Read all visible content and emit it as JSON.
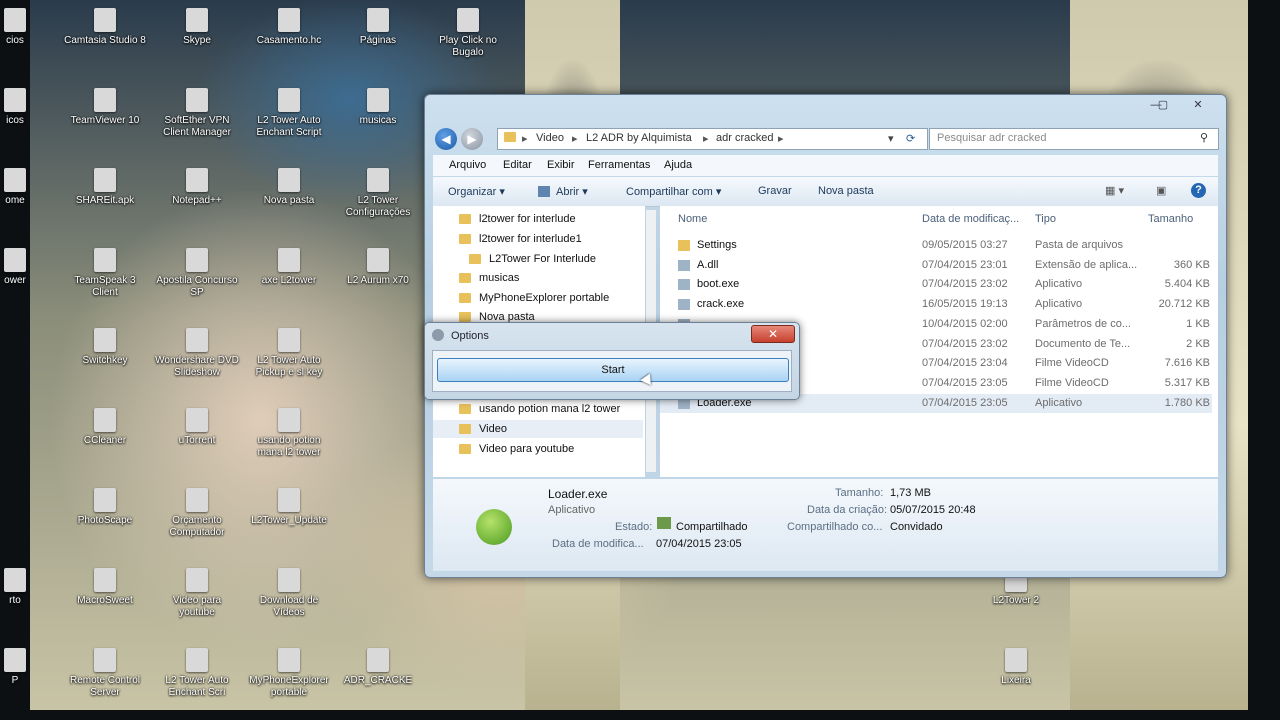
{
  "desktop_icons": [
    {
      "label": "cios",
      "icon": "app-icon"
    },
    {
      "label": "Camtasia Studio 8",
      "icon": "camtasia-icon"
    },
    {
      "label": "Skype",
      "icon": "skype-icon"
    },
    {
      "label": "Casamento.hc",
      "icon": "file-icon"
    },
    {
      "label": "Páginas",
      "icon": "file-icon"
    },
    {
      "label": "Play Click no Bugalo",
      "icon": "app-icon"
    },
    {
      "label": "icos",
      "icon": "app-icon"
    },
    {
      "label": "TeamViewer 10",
      "icon": "teamviewer-icon"
    },
    {
      "label": "SoftEther VPN Client Manager",
      "icon": "vpn-icon"
    },
    {
      "label": "L2 Tower Auto Enchant Script",
      "icon": "file-icon"
    },
    {
      "label": "musicas",
      "icon": "folder-icon"
    },
    {
      "label": "ome",
      "icon": "app-icon"
    },
    {
      "label": "SHAREit.apk",
      "icon": "file-icon"
    },
    {
      "label": "Notepad++",
      "icon": "notepad-icon"
    },
    {
      "label": "Nova pasta",
      "icon": "folder-icon"
    },
    {
      "label": "L2 Tower Configurações",
      "icon": "file-icon"
    },
    {
      "label": "ower",
      "icon": "app-icon"
    },
    {
      "label": "TeamSpeak 3 Client",
      "icon": "teamspeak-icon"
    },
    {
      "label": "Apostila Concurso SP",
      "icon": "doc-icon"
    },
    {
      "label": "axe L2tower",
      "icon": "file-icon"
    },
    {
      "label": "L2 Aurum x70",
      "icon": "game-icon"
    },
    {
      "label": "Switchkey",
      "icon": "app-icon"
    },
    {
      "label": "Wondershare DVD Slideshow",
      "icon": "app-icon"
    },
    {
      "label": "L2 Tower Auto Pickup e sl key",
      "icon": "file-icon"
    },
    {
      "label": "CCleaner",
      "icon": "ccleaner-icon"
    },
    {
      "label": "uTorrent",
      "icon": "utorrent-icon"
    },
    {
      "label": "usando potion mana l2 tower",
      "icon": "file-icon"
    },
    {
      "label": "PhotoScape",
      "icon": "photoscape-icon"
    },
    {
      "label": "Orçamento Computador",
      "icon": "doc-icon"
    },
    {
      "label": "L2Tower_Update",
      "icon": "file-icon"
    },
    {
      "label": "rto",
      "icon": "app-icon"
    },
    {
      "label": "MacroSweet",
      "icon": "app-icon"
    },
    {
      "label": "Video para youtube",
      "icon": "file-icon"
    },
    {
      "label": "Download de Vídeos",
      "icon": "file-icon"
    },
    {
      "label": "L2Tower 2",
      "icon": "app-icon"
    },
    {
      "label": "P",
      "icon": "app-icon"
    },
    {
      "label": "Remote Control Server",
      "icon": "app-icon"
    },
    {
      "label": "L2 Tower Auto Enchant Scri",
      "icon": "file-icon"
    },
    {
      "label": "MyPhoneExplorer portable",
      "icon": "file-icon"
    },
    {
      "label": "ADR_CRACKE",
      "icon": "file-icon"
    },
    {
      "label": "Lixeira",
      "icon": "recycle-bin-icon"
    }
  ],
  "explorer": {
    "window_controls": {
      "minimize": "—",
      "maximize": "▢",
      "close": "✕"
    },
    "address": {
      "segments": [
        "Video",
        "L2 ADR by Alquimista",
        "adr cracked"
      ],
      "sep": "▸"
    },
    "search_placeholder": "Pesquisar adr cracked",
    "menu": [
      "Arquivo",
      "Editar",
      "Exibir",
      "Ferramentas",
      "Ajuda"
    ],
    "commands": {
      "organize": "Organizar ▾",
      "open": "Abrir ▾",
      "share": "Compartilhar com ▾",
      "burn": "Gravar",
      "new_folder": "Nova pasta"
    },
    "nav_items": [
      {
        "label": "l2tower for interlude",
        "indent": 0
      },
      {
        "label": "l2tower for interlude1",
        "indent": 0
      },
      {
        "label": "L2Tower For Interlude",
        "indent": 1
      },
      {
        "label": "musicas",
        "indent": 0
      },
      {
        "label": "MyPhoneExplorer portable",
        "indent": 0
      },
      {
        "label": "Nova pasta",
        "indent": 0
      },
      {
        "label": "usando potion mana l2 tower",
        "indent": 0
      },
      {
        "label": "Video",
        "indent": 0
      },
      {
        "label": "Video para youtube",
        "indent": 0
      }
    ],
    "columns": {
      "name": "Nome",
      "date": "Data de modificaç...",
      "type": "Tipo",
      "size": "Tamanho"
    },
    "files": [
      {
        "name": "Settings",
        "date": "09/05/2015 03:27",
        "type": "Pasta de arquivos",
        "size": ""
      },
      {
        "name": "A.dll",
        "date": "07/04/2015 23:01",
        "type": "Extensão de aplica...",
        "size": "360 KB"
      },
      {
        "name": "boot.exe",
        "date": "07/04/2015 23:02",
        "type": "Aplicativo",
        "size": "5.404 KB"
      },
      {
        "name": "crack.exe",
        "date": "16/05/2015 19:13",
        "type": "Aplicativo",
        "size": "20.712 KB"
      },
      {
        "name": "",
        "date": "10/04/2015 02:00",
        "type": "Parâmetros de co...",
        "size": "1 KB"
      },
      {
        "name": "",
        "date": "07/04/2015 23:02",
        "type": "Documento de Te...",
        "size": "2 KB"
      },
      {
        "name": "",
        "date": "07/04/2015 23:04",
        "type": "Filme VideoCD",
        "size": "7.616 KB"
      },
      {
        "name": "",
        "date": "07/04/2015 23:05",
        "type": "Filme VideoCD",
        "size": "5.317 KB"
      },
      {
        "name": "Loader.exe",
        "date": "07/04/2015 23:05",
        "type": "Aplicativo",
        "size": "1.780 KB"
      }
    ],
    "details": {
      "name": "Loader.exe",
      "kind": "Aplicativo",
      "state_label": "Estado:",
      "state": "Compartilhado",
      "modified_label": "Data de modifica...",
      "modified": "07/04/2015 23:05",
      "size_label": "Tamanho:",
      "size": "1,73 MB",
      "created_label": "Data da criação:",
      "created": "05/07/2015 20:48",
      "shared_label": "Compartilhado co...",
      "shared": "Convidado"
    }
  },
  "options_dialog": {
    "title": "Options",
    "close": "✕",
    "start": "Start"
  }
}
